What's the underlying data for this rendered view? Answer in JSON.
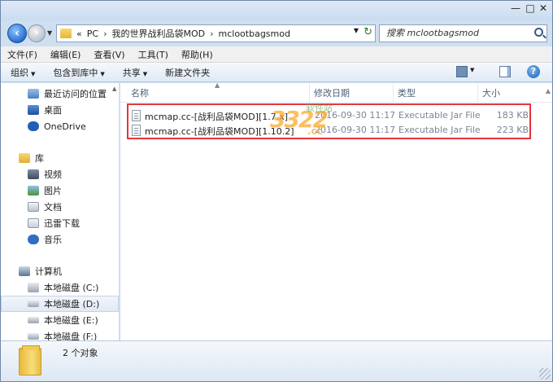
{
  "window": {
    "controls": {
      "minimize": "—",
      "maximize": "□",
      "close": "✕"
    }
  },
  "nav": {
    "back_icon": "back-arrow-icon",
    "forward_icon": "forward-arrow-icon",
    "breadcrumb_prefix": "«",
    "breadcrumbs": [
      "PC",
      "我的世界战利品袋MOD",
      "mclootbagsmod"
    ],
    "separator": "›",
    "search_placeholder": "搜索 mclootbagsmod"
  },
  "menu": [
    "文件(F)",
    "编辑(E)",
    "查看(V)",
    "工具(T)",
    "帮助(H)"
  ],
  "commands": {
    "organize": "组织",
    "include_in_library": "包含到库中",
    "share": "共享",
    "new_folder": "新建文件夹"
  },
  "sidebar": {
    "items": [
      {
        "label": "最近访问的位置",
        "icon": "recent-places-icon"
      },
      {
        "label": "桌面",
        "icon": "desktop-icon"
      },
      {
        "label": "OneDrive",
        "icon": "onedrive-cloud-icon"
      },
      {
        "label": "库",
        "icon": "library-icon"
      },
      {
        "label": "视频",
        "icon": "video-icon"
      },
      {
        "label": "图片",
        "icon": "picture-icon"
      },
      {
        "label": "文档",
        "icon": "document-icon"
      },
      {
        "label": "迅雷下载",
        "icon": "download-icon"
      },
      {
        "label": "音乐",
        "icon": "music-icon"
      },
      {
        "label": "计算机",
        "icon": "computer-icon"
      },
      {
        "label": "本地磁盘 (C:)",
        "icon": "drive-c-icon"
      },
      {
        "label": "本地磁盘 (D:)",
        "icon": "drive-icon"
      },
      {
        "label": "本地磁盘 (E:)",
        "icon": "drive-icon"
      },
      {
        "label": "本地磁盘 (F:)",
        "icon": "drive-icon"
      }
    ],
    "selected": "本地磁盘 (D:)"
  },
  "columns": {
    "name": "名称",
    "date": "修改日期",
    "type": "类型",
    "size": "大小"
  },
  "files": [
    {
      "name": "mcmap.cc-[战利品袋MOD][1.7.x]",
      "date": "2016-09-30 11:17",
      "type": "Executable Jar File",
      "size": "183 KB"
    },
    {
      "name": "mcmap.cc-[战利品袋MOD][1.10.2]",
      "date": "2016-09-30 11:17",
      "type": "Executable Jar File",
      "size": "223 KB"
    }
  ],
  "watermark": {
    "number": "3322",
    "site": "软件站",
    "suffix": ".cc"
  },
  "status": {
    "item_count": "2 个对象"
  },
  "colors": {
    "highlight_border": "#e8343b",
    "window_frame": "#c3d6ec"
  }
}
